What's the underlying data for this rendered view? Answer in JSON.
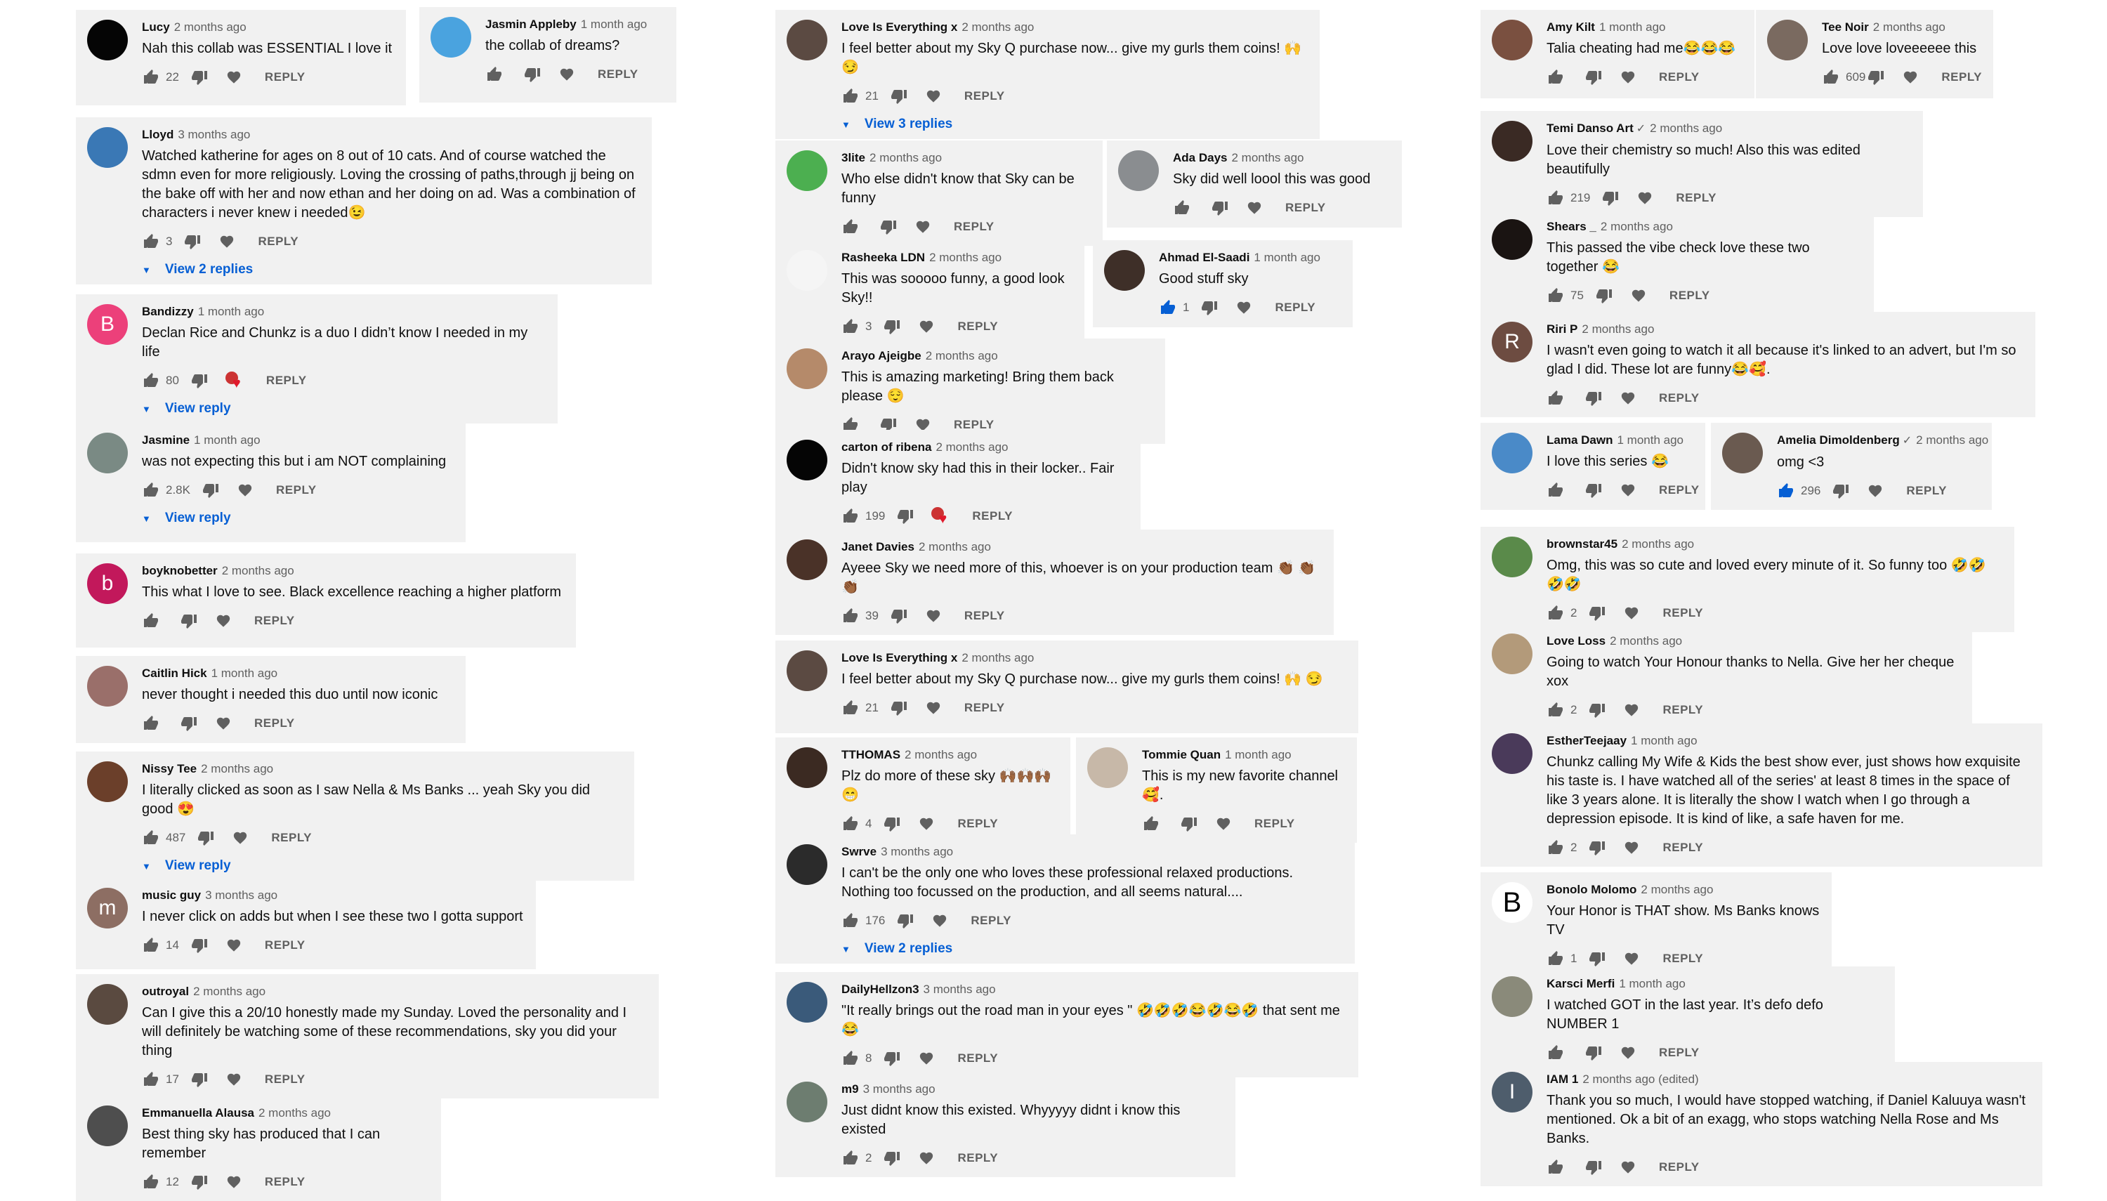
{
  "comments": [
    {
      "author": "Lucy",
      "time": "2 months ago",
      "text": "Nah this collab was ESSENTIAL I love it",
      "likes": "22",
      "reply": "REPLY",
      "avatar_letter": "",
      "avatar_color": "#050505"
    },
    {
      "author": "Jasmin Appleby",
      "time": "1 month ago",
      "text": "the collab of dreams?",
      "likes": "",
      "reply": "REPLY",
      "avatar_letter": "",
      "avatar_color": "#4aa3df"
    },
    {
      "author": "Lloyd",
      "time": "3 months ago",
      "text": "Watched katherine for ages on 8 out of 10 cats. And of course watched the sdmn even for more religiously. Loving the crossing of paths,through jj being on the bake off with her and now ethan and her doing on ad. Was a combination of characters i never knew i needed😉",
      "likes": "3",
      "reply": "REPLY",
      "view_replies": "View 2 replies",
      "avatar_letter": "",
      "avatar_color": "#3a78b5"
    },
    {
      "author": "Bandizzy",
      "time": "1 month ago",
      "text": "Declan Rice and Chunkz is a duo I didn’t know I needed in my life",
      "likes": "80",
      "reply": "REPLY",
      "view_replies": "View reply",
      "avatar_letter": "B",
      "avatar_color": "#ec407a"
    },
    {
      "author": "Jasmine",
      "time": "1 month ago",
      "text": "was not expecting this but i am NOT complaining",
      "likes": "2.8K",
      "reply": "REPLY",
      "view_replies": "View reply",
      "avatar_letter": "",
      "avatar_color": "#7a8a84"
    },
    {
      "author": "boyknobetter",
      "time": "2 months ago",
      "text": "This what I love to see. Black excellence reaching a higher platform",
      "likes": "",
      "reply": "REPLY",
      "avatar_letter": "b",
      "avatar_color": "#c2185b"
    },
    {
      "author": "Caitlin Hick",
      "time": "1 month ago",
      "text": "never thought i needed this duo until now iconic",
      "likes": "",
      "reply": "REPLY",
      "avatar_letter": "",
      "avatar_color": "#9a6f6a"
    },
    {
      "author": "Nissy Tee",
      "time": "2 months ago",
      "text": "I literally clicked as soon as I saw Nella & Ms Banks ... yeah Sky you did good 😍",
      "likes": "487",
      "reply": "REPLY",
      "view_replies": "View reply",
      "avatar_letter": "",
      "avatar_color": "#6b3f2a"
    },
    {
      "author": "music guy",
      "time": "3 months ago",
      "text": "I never click on adds but when I see these two I gotta support",
      "likes": "14",
      "reply": "REPLY",
      "avatar_letter": "m",
      "avatar_color": "#8d6e63"
    },
    {
      "author": "outroyal",
      "time": "2 months ago",
      "text": "Can I give this a 20/10 honestly made my Sunday. Loved the personality and I will definitely be watching some of these recommendations, sky you did your thing",
      "likes": "17",
      "reply": "REPLY",
      "avatar_letter": "",
      "avatar_color": "#5a4a40"
    },
    {
      "author": "Emmanuella Alausa",
      "time": "2 months ago",
      "text": "Best thing sky has produced that I can remember",
      "likes": "12",
      "reply": "REPLY",
      "avatar_letter": "",
      "avatar_color": "#4e4e4e"
    },
    {
      "author": "Love Is Everything x",
      "time": "2 months ago",
      "text": "I feel better about my Sky Q purchase now... give my gurls them coins! 🙌 😏",
      "likes": "21",
      "reply": "REPLY",
      "view_replies": "View 3 replies",
      "avatar_letter": "",
      "avatar_color": "#5b4a42"
    },
    {
      "author": "3lite",
      "time": "2 months ago",
      "text": "Who else didn't know that Sky can be funny",
      "likes": "",
      "reply": "REPLY",
      "avatar_letter": "",
      "avatar_color": "#4caf50"
    },
    {
      "author": "Ada Days",
      "time": "2 months ago",
      "text": "Sky did well loool this was good",
      "likes": "",
      "reply": "REPLY",
      "avatar_letter": "",
      "avatar_color": "#8a8d90"
    },
    {
      "author": "Rasheeka LDN",
      "time": "2 months ago",
      "text": "This was sooooo funny, a good look Sky!!",
      "likes": "3",
      "reply": "REPLY",
      "avatar_letter": "",
      "avatar_color": "#f5f5f5"
    },
    {
      "author": "Ahmad El-Saadi",
      "time": "1 month ago",
      "text": "Good stuff sky",
      "likes": "1",
      "reply": "REPLY",
      "avatar_letter": "",
      "avatar_color": "#3e2f28"
    },
    {
      "author": "Arayo Ajeigbe",
      "time": "2 months ago",
      "text": "This is amazing marketing! Bring them back please 😌",
      "likes": "",
      "reply": "REPLY",
      "avatar_letter": "",
      "avatar_color": "#b58a6a"
    },
    {
      "author": "carton of ribena",
      "time": "2 months ago",
      "text": "Didn't know sky had this in their locker.. Fair play",
      "likes": "199",
      "reply": "REPLY",
      "avatar_letter": "",
      "avatar_color": "#050505"
    },
    {
      "author": "Janet Davies",
      "time": "2 months ago",
      "text": "Ayeee Sky we need more of this, whoever is on your production team 👏🏾 👏🏾 👏🏾",
      "likes": "39",
      "reply": "REPLY",
      "avatar_letter": "",
      "avatar_color": "#4a3228"
    },
    {
      "author": "Love Is Everything x",
      "time": "2 months ago",
      "text": "I feel better about my Sky Q purchase now... give my gurls them coins! 🙌 😏",
      "likes": "21",
      "reply": "REPLY",
      "avatar_letter": "",
      "avatar_color": "#5b4a42"
    },
    {
      "author": "TTHOMAS",
      "time": "2 months ago",
      "text": "Plz do more of these sky 🙌🏾🙌🏾🙌🏾😁",
      "likes": "4",
      "reply": "REPLY",
      "avatar_letter": "",
      "avatar_color": "#3b2a22"
    },
    {
      "author": "Tommie Quan",
      "time": "1 month ago",
      "text": "This is my new favorite channel 🥰.",
      "likes": "",
      "reply": "REPLY",
      "avatar_letter": "",
      "avatar_color": "#c7b8a8"
    },
    {
      "author": "Swrve",
      "time": "3 months ago",
      "text": "I can't be the only one who loves these professional relaxed productions. Nothing too focussed on the production, and all seems natural....",
      "likes": "176",
      "reply": "REPLY",
      "view_replies": "View 2 replies",
      "avatar_letter": "",
      "avatar_color": "#2b2b2b"
    },
    {
      "author": "DailyHellzon3",
      "time": "3 months ago",
      "text": "\"It really brings out the road man in your eyes \" 🤣🤣🤣😂🤣😂🤣 that sent me 😂",
      "likes": "8",
      "reply": "REPLY",
      "avatar_letter": "",
      "avatar_color": "#3a5a7a"
    },
    {
      "author": "m9",
      "time": "3 months ago",
      "text": "Just didnt know this existed. Whyyyyy didnt i know this existed",
      "likes": "2",
      "reply": "REPLY",
      "avatar_letter": "",
      "avatar_color": "#6d7d70"
    },
    {
      "author": "Amy Kilt",
      "time": "1 month ago",
      "text": "Talia cheating had me😂😂😂",
      "likes": "",
      "reply": "REPLY",
      "avatar_letter": "",
      "avatar_color": "#7a5040"
    },
    {
      "author": "Tee Noir",
      "time": "2 months ago",
      "text": "Love love loveeeeee this",
      "likes": "609",
      "reply": "REPLY",
      "avatar_letter": "",
      "avatar_color": "#7a6a60"
    },
    {
      "author": "Temi Danso Art",
      "verified": "✓",
      "time": "2 months ago",
      "text": "Love their chemistry so much! Also this was edited beautifully",
      "likes": "219",
      "reply": "REPLY",
      "avatar_letter": "",
      "avatar_color": "#3a2a24"
    },
    {
      "author": "Shears _",
      "time": "2 months ago",
      "text": "This passed the vibe check love these two together 😂",
      "likes": "75",
      "reply": "REPLY",
      "avatar_letter": "",
      "avatar_color": "#1a1412"
    },
    {
      "author": "Riri P",
      "time": "2 months ago",
      "text": "I wasn't even going to watch it all because it's linked to an advert, but I'm so glad I did. These lot are funny😂🥰.",
      "likes": "",
      "reply": "REPLY",
      "avatar_letter": "R",
      "avatar_color": "#6d4c41"
    },
    {
      "author": "Lama Dawn",
      "time": "1 month ago",
      "text": "I love this series 😂",
      "likes": "",
      "reply": "REPLY",
      "avatar_letter": "",
      "avatar_color": "#4a8ac8"
    },
    {
      "author": "Amelia Dimoldenberg",
      "verified": "✓",
      "time": "2 months ago",
      "text": "omg <3",
      "likes": "296",
      "reply": "REPLY",
      "avatar_letter": "",
      "avatar_color": "#6a5a50"
    },
    {
      "author": "brownstar45",
      "time": "2 months ago",
      "text": "Omg, this was so cute and loved every minute of it.  So funny too 🤣🤣🤣🤣",
      "likes": "2",
      "reply": "REPLY",
      "avatar_letter": "",
      "avatar_color": "#5a8a4a"
    },
    {
      "author": "Love Loss",
      "time": "2 months ago",
      "text": "Going to watch Your Honour thanks to Nella. Give her her cheque xox",
      "likes": "2",
      "reply": "REPLY",
      "avatar_letter": "",
      "avatar_color": "#b39a7a"
    },
    {
      "author": "EstherTeejaay",
      "time": "1 month ago",
      "text": "Chunkz calling My Wife & Kids the best show ever, just shows how exquisite his taste is. I have watched all of the series' at least 8 times in the space of like 3 years alone. It is literally the show I watch when I go through a depression episode. It is kind of like, a safe haven for me.",
      "likes": "2",
      "reply": "REPLY",
      "avatar_letter": "",
      "avatar_color": "#4a3a5a"
    },
    {
      "author": "Bonolo Molomo",
      "time": "2 months ago",
      "text": "Your Honor is THAT show. Ms Banks knows TV",
      "likes": "1",
      "reply": "REPLY",
      "avatar_letter": "B",
      "avatar_color": "#ffffff"
    },
    {
      "author": "Karsci Merfi",
      "time": "1 month ago",
      "text": "I watched GOT in the last year. It’s defo defo NUMBER 1",
      "likes": "",
      "reply": "REPLY",
      "avatar_letter": "",
      "avatar_color": "#8a8a7a"
    },
    {
      "author": "IAM 1",
      "time": "2 months ago (edited)",
      "text": "Thank you so much, I would have stopped watching, if Daniel Kaluuya wasn't mentioned. Ok a bit of an exagg, who stops watching Nella Rose and Ms Banks.",
      "likes": "",
      "reply": "REPLY",
      "avatar_letter": "I",
      "avatar_color": "#4e5d6c"
    }
  ]
}
